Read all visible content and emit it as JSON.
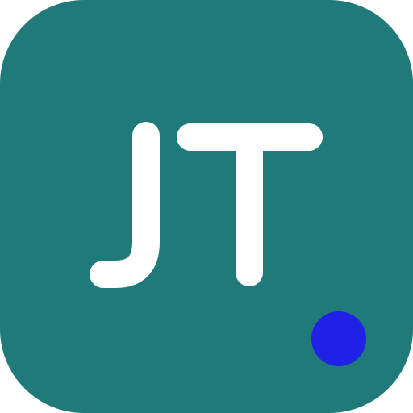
{
  "logo": {
    "monogram": "JT",
    "colors": {
      "tile": "#217A7A",
      "letters": "#FFFFFF",
      "dot": "#1F21E6"
    },
    "icon": "monogram-logo-icon"
  }
}
